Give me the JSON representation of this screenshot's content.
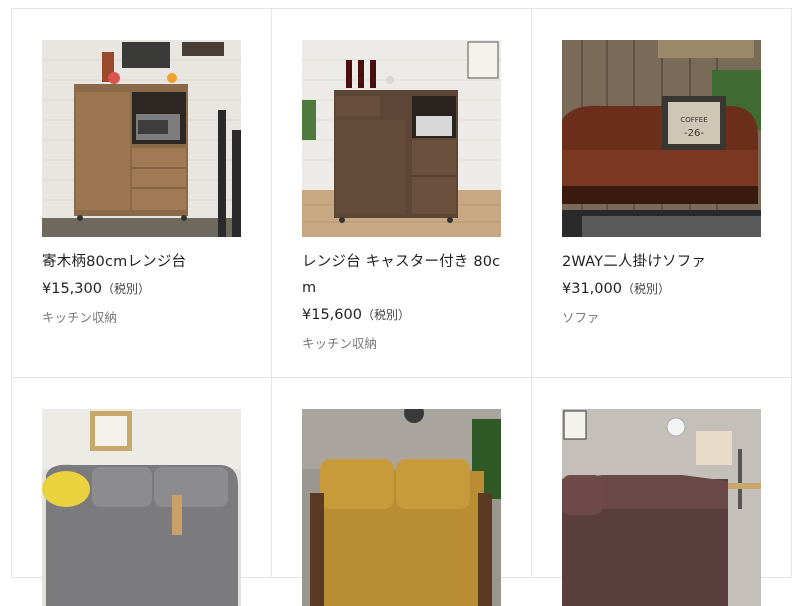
{
  "products": [
    {
      "title": "寄木柄80cmレンジ台",
      "price": "¥15,300",
      "tax": "（税別）",
      "category": "キッチン収納",
      "image": "kitchen-cabinet-patchwork"
    },
    {
      "title": "レンジ台 キャスター付き 80cm",
      "price": "¥15,600",
      "tax": "（税別）",
      "category": "キッチン収納",
      "image": "kitchen-cabinet-walnut"
    },
    {
      "title": "2WAY二人掛けソファ",
      "price": "¥31,000",
      "tax": "（税別）",
      "category": "ソファ",
      "image": "leather-sofa-brown"
    },
    {
      "image": "fabric-sofa-gray"
    },
    {
      "image": "fabric-sofa-mustard"
    },
    {
      "image": "fabric-sofa-brown"
    }
  ]
}
